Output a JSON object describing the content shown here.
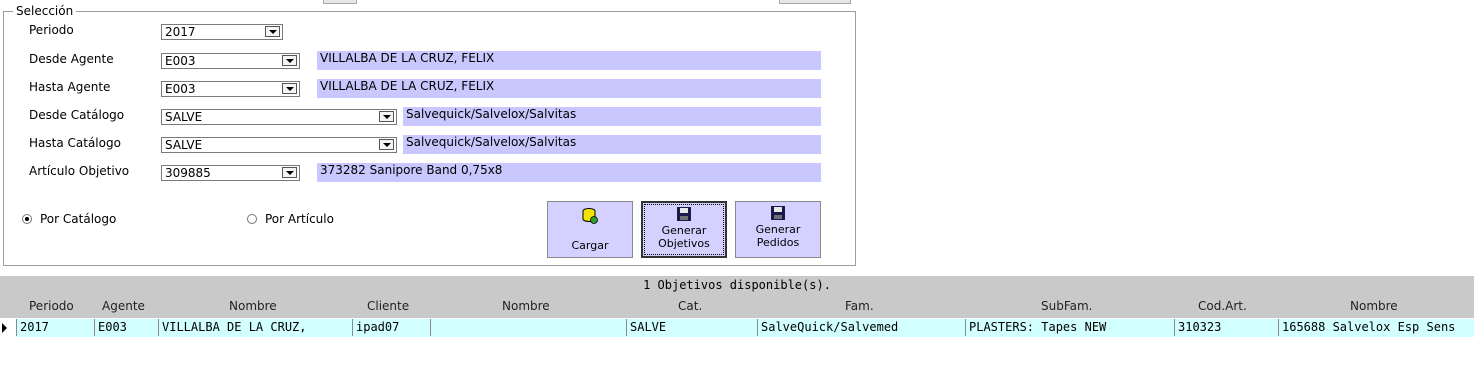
{
  "seleccion": {
    "legend": "Selección",
    "periodo": {
      "label": "Periodo",
      "value": "2017"
    },
    "desde_agente": {
      "label": "Desde Agente",
      "value": "E003",
      "desc": "VILLALBA DE LA CRUZ, FELIX"
    },
    "hasta_agente": {
      "label": "Hasta Agente",
      "value": "E003",
      "desc": "VILLALBA DE LA CRUZ, FELIX"
    },
    "desde_catalogo": {
      "label": "Desde Catálogo",
      "value": "SALVE",
      "desc": "Salvequick/Salvelox/Salvitas"
    },
    "hasta_catalogo": {
      "label": "Hasta Catálogo",
      "value": "SALVE",
      "desc": "Salvequick/Salvelox/Salvitas"
    },
    "articulo_objetivo": {
      "label": "Artículo Objetivo",
      "value": "309885",
      "desc": "373282 Sanipore Band 0,75x8"
    },
    "radio_catalogo": {
      "label": "Por Catálogo",
      "checked": true
    },
    "radio_articulo": {
      "label": "Por Artículo",
      "checked": false
    }
  },
  "buttons": {
    "cargar": "Cargar",
    "generar_objetivos_1": "Generar",
    "generar_objetivos_2": "Objetivos",
    "generar_pedidos_1": "Generar",
    "generar_pedidos_2": "Pedidos"
  },
  "grid": {
    "status": "1 Objetivos disponible(s).",
    "columns": [
      "Periodo",
      "Agente",
      "Nombre",
      "Cliente",
      "Nombre",
      "Cat.",
      "Fam.",
      "SubFam.",
      "Cod.Art.",
      "Nombre"
    ],
    "rows": [
      [
        "2017",
        "E003",
        "VILLALBA DE LA CRUZ,",
        "ipad07",
        "",
        "SALVE",
        "SalveQuick/Salvemed",
        "PLASTERS: Tapes NEW",
        "310323",
        "165688 Salvelox Esp Sens"
      ]
    ]
  },
  "colors": {
    "description_bg": "#c8c8ff",
    "row_bg": "#d2ffff",
    "header_bg": "#c9c9c9"
  }
}
